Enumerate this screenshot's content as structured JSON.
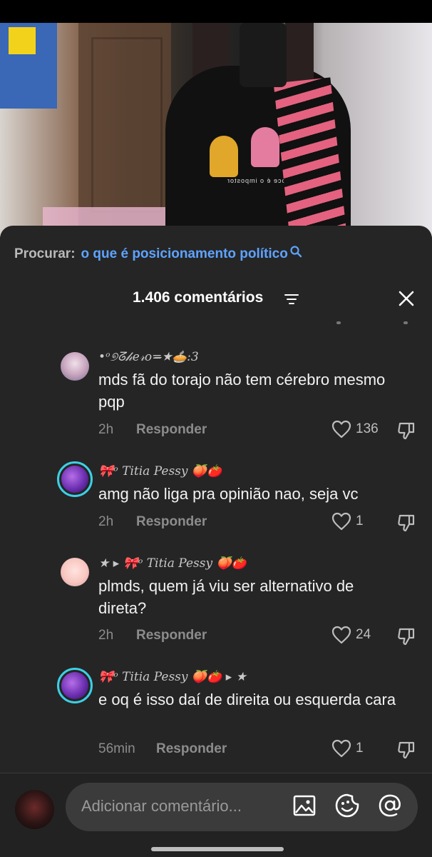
{
  "search": {
    "prefix": "Procurar:",
    "query": "o que é posicionamento político"
  },
  "header": {
    "title": "1.406 comentários"
  },
  "video": {
    "shirt_text": "voce é o impostor"
  },
  "comments": [
    {
      "username": "•ᵒ୭ᘔ𝒽𝑒𝓇𝑜=̶★🥧:3",
      "text": "mds fã do torajo não tem cérebro mesmo pqp",
      "time": "2h",
      "reply_label": "Responder",
      "likes": "136"
    },
    {
      "username": "🎀ᵒ Titia Pessy 🍑🍅",
      "text": "amg não liga pra opinião nao, seja vc",
      "time": "2h",
      "reply_label": "Responder",
      "likes": "1"
    },
    {
      "username": "★ ▸ 🎀ᵒ Titia Pessy 🍑🍅",
      "text": "plmds, quem já viu ser alternativo de direta?",
      "time": "2h",
      "reply_label": "Responder",
      "likes": "24"
    },
    {
      "username": "🎀ᵒ Titia Pessy 🍑🍅 ▸ ★",
      "text": "e oq é isso daí de direita ou esquerda cara",
      "time": "56min",
      "reply_label": "Responder",
      "likes": "1"
    }
  ],
  "input": {
    "placeholder": "Adicionar comentário..."
  },
  "colors": {
    "sheet_bg": "#252525",
    "search_query": "#5ea3ff",
    "avatar_ring": "#3dcfe5"
  }
}
